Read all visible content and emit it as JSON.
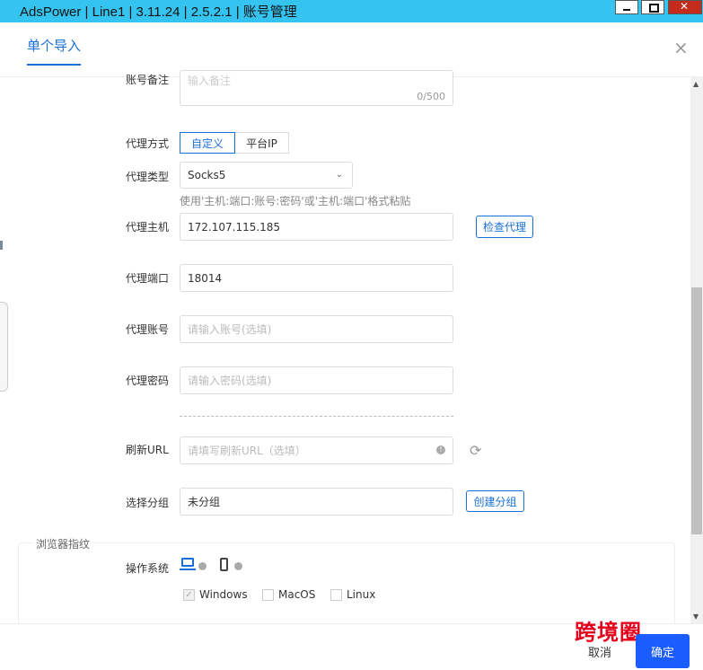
{
  "window": {
    "title": "AdsPower | Line1 | 3.11.24 | 2.5.2.1 | 账号管理"
  },
  "modal": {
    "tab_label": "单个导入",
    "close_glyph": "×"
  },
  "form": {
    "remark": {
      "label": "账号备注",
      "placeholder": "输入备注",
      "counter": "0/500"
    },
    "proxy_method": {
      "label": "代理方式",
      "options": [
        "自定义",
        "平台IP"
      ],
      "selected": "自定义"
    },
    "proxy_type": {
      "label": "代理类型",
      "value": "Socks5"
    },
    "paste_hint": "使用'主机:端口:账号:密码'或'主机:端口'格式粘贴",
    "proxy_host": {
      "label": "代理主机",
      "value": "172.107.115.185",
      "check_button": "检查代理"
    },
    "proxy_port": {
      "label": "代理端口",
      "value": "18014"
    },
    "proxy_account": {
      "label": "代理账号",
      "placeholder": "请输入账号(选填)"
    },
    "proxy_password": {
      "label": "代理密码",
      "placeholder": "请输入密码(选填)"
    },
    "refresh_url": {
      "label": "刷新URL",
      "placeholder": "请填写刷新URL（选填）"
    },
    "group": {
      "label": "选择分组",
      "value": "未分组",
      "create_button": "创建分组"
    }
  },
  "fingerprint": {
    "legend": "浏览器指纹",
    "os_label": "操作系统",
    "os_options": [
      {
        "label": "Windows",
        "checked": true
      },
      {
        "label": "MacOS",
        "checked": false
      },
      {
        "label": "Linux",
        "checked": false
      }
    ]
  },
  "footer": {
    "cancel_label": "取消",
    "confirm_label": "确定"
  },
  "watermark": "跨境圈",
  "colors": {
    "accent": "#1a6fd6",
    "titlebar": "#35c4f0",
    "confirm": "#1a5cff",
    "watermark": "#e3001b"
  }
}
